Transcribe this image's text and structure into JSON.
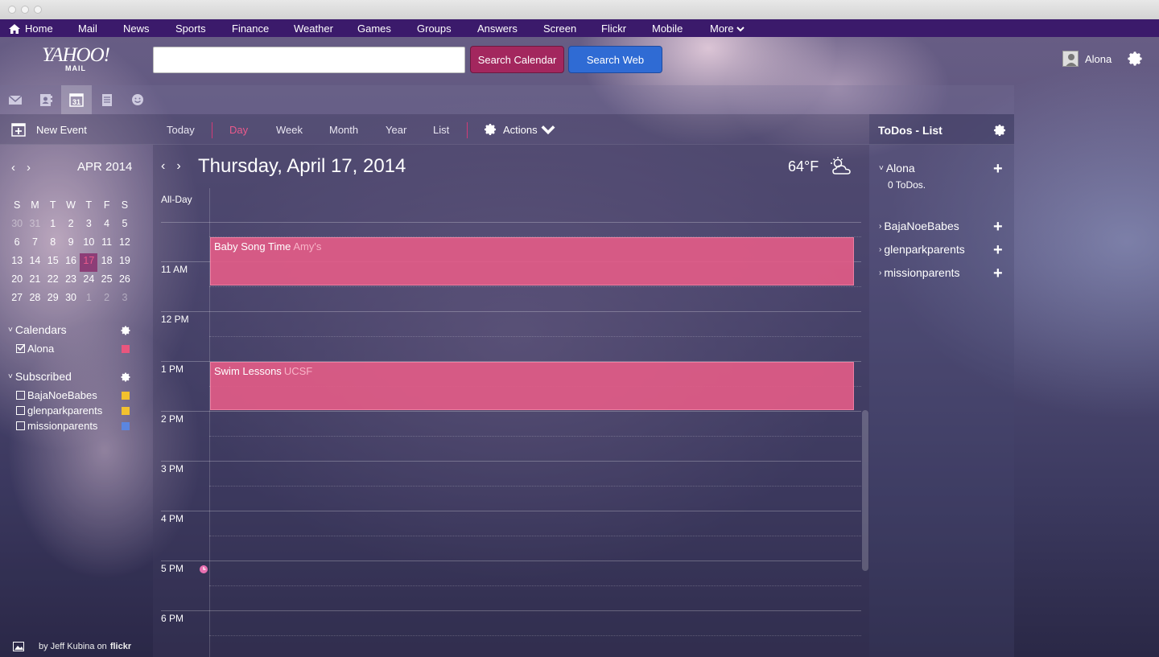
{
  "topnav": {
    "items": [
      "Home",
      "Mail",
      "News",
      "Sports",
      "Finance",
      "Weather",
      "Games",
      "Groups",
      "Answers",
      "Screen",
      "Flickr",
      "Mobile",
      "More"
    ]
  },
  "header": {
    "logo_main": "YAHOO!",
    "logo_sub": "MAIL",
    "search_placeholder": "",
    "search_calendar_label": "Search Calendar",
    "search_web_label": "Search Web",
    "user_name": "Alona"
  },
  "toolbar": {
    "new_event_label": "New Event",
    "views": [
      "Today",
      "Day",
      "Week",
      "Month",
      "Year",
      "List"
    ],
    "active_view": "Day",
    "actions_label": "Actions"
  },
  "minical": {
    "month_label": "APR 2014",
    "weekdays": [
      "S",
      "M",
      "T",
      "W",
      "T",
      "F",
      "S"
    ],
    "weeks": [
      [
        "30",
        "31",
        "1",
        "2",
        "3",
        "4",
        "5"
      ],
      [
        "6",
        "7",
        "8",
        "9",
        "10",
        "11",
        "12"
      ],
      [
        "13",
        "14",
        "15",
        "16",
        "17",
        "18",
        "19"
      ],
      [
        "20",
        "21",
        "22",
        "23",
        "24",
        "25",
        "26"
      ],
      [
        "27",
        "28",
        "29",
        "30",
        "1",
        "2",
        "3"
      ]
    ],
    "today": "17"
  },
  "calendars": {
    "label": "Calendars",
    "items": [
      {
        "name": "Alona",
        "checked": true,
        "color": "#e8567e"
      }
    ]
  },
  "subscribed": {
    "label": "Subscribed",
    "items": [
      {
        "name": "BajaNoeBabes",
        "checked": false,
        "color": "#f2c12e"
      },
      {
        "name": "glenparkparents",
        "checked": false,
        "color": "#f2c12e"
      },
      {
        "name": "missionparents",
        "checked": false,
        "color": "#5b86e0"
      }
    ]
  },
  "credit": {
    "prefix": "by Jeff Kubina on",
    "brand": "flickr"
  },
  "dayview": {
    "title": "Thursday, April 17, 2014",
    "temperature": "64°F",
    "weather_icon": "partly-cloudy-icon",
    "allday_label": "All-Day",
    "hours": [
      "11 AM",
      "12 PM",
      "1 PM",
      "2 PM",
      "3 PM",
      "4 PM",
      "5 PM",
      "6 PM"
    ],
    "events": [
      {
        "title": "Baby Song Time",
        "location": "Amy's"
      },
      {
        "title": "Swim Lessons",
        "location": "UCSF"
      }
    ]
  },
  "todos": {
    "title": "ToDos - List",
    "lists": [
      {
        "name": "Alona",
        "count_label": "0 ToDos.",
        "expanded": true
      },
      {
        "name": "BajaNoeBabes",
        "expanded": false
      },
      {
        "name": "glenparkparents",
        "expanded": false
      },
      {
        "name": "missionparents",
        "expanded": false
      }
    ]
  },
  "colors": {
    "accent": "#ea5a8c",
    "nav_bg": "#3b1a6b",
    "search_calendar_bg": "#a3275e",
    "search_web_bg": "#2f6bd4",
    "event_bg": "#e45c87"
  }
}
